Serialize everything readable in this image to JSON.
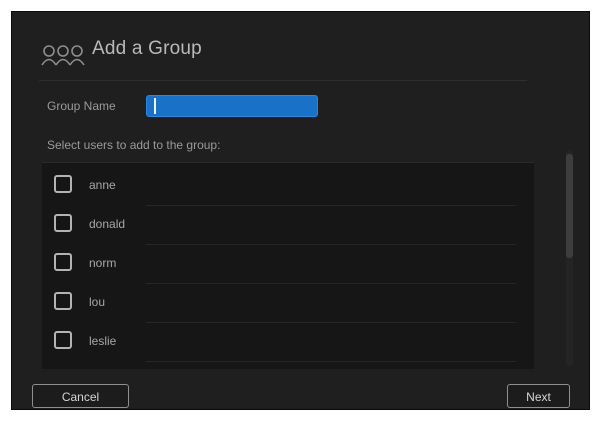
{
  "dialog": {
    "title": "Add a Group",
    "icon": "group-users-icon"
  },
  "form": {
    "group_name_label": "Group Name",
    "group_name_value": "",
    "instruction": "Select users to add to the group:"
  },
  "users": [
    {
      "name": "anne",
      "checked": false
    },
    {
      "name": "donald",
      "checked": false
    },
    {
      "name": "norm",
      "checked": false
    },
    {
      "name": "lou",
      "checked": false
    },
    {
      "name": "leslie",
      "checked": false
    }
  ],
  "buttons": {
    "cancel_label": "Cancel",
    "next_label": "Next"
  },
  "colors": {
    "dialog_bg": "#1f1f1f",
    "input_accent": "#1971c8",
    "text_primary": "#b9b9b9",
    "text_secondary": "#9a9a9a"
  }
}
